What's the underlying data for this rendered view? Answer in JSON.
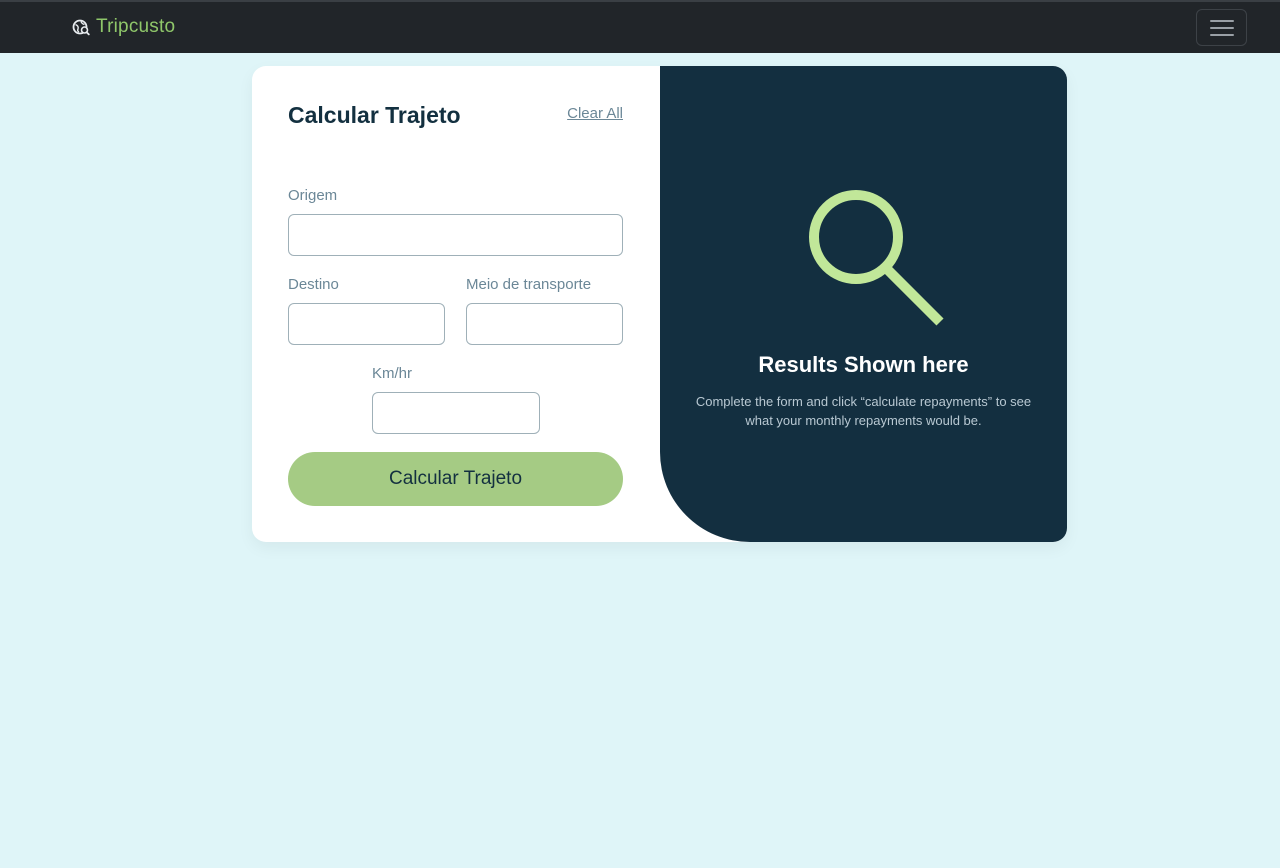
{
  "navbar": {
    "brand_name": "Tripcusto",
    "brand_icon": "globe-icon",
    "menu_icon": "hamburger-menu-icon"
  },
  "form": {
    "title": "Calcular Trajeto",
    "clear_label": "Clear All",
    "origin": {
      "label": "Origem",
      "value": "",
      "placeholder": ""
    },
    "destination": {
      "label": "Destino",
      "value": "",
      "placeholder": ""
    },
    "transport": {
      "label": "Meio de transporte",
      "value": "",
      "placeholder": ""
    },
    "speed": {
      "label": "Km/hr",
      "value": "",
      "placeholder": ""
    },
    "submit_label": "Calcular Trajeto"
  },
  "results": {
    "icon": "search-icon",
    "title": "Results Shown here",
    "description": "Complete the form and click “calculate repayments” to see what your monthly repayments would be."
  },
  "colors": {
    "page_background": "#dff5f8",
    "navbar_background": "#212529",
    "brand_green": "#8fc76a",
    "accent_lime": "#a5cb84",
    "results_background": "#132f40",
    "search_icon": "#c1e799"
  }
}
